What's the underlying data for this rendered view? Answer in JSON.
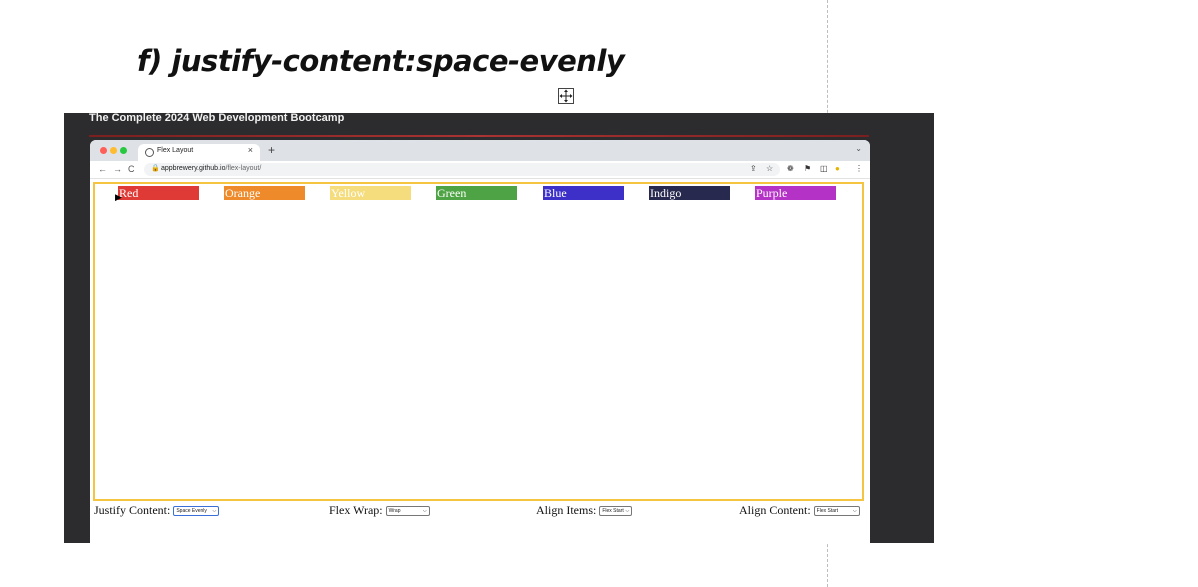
{
  "document": {
    "heading": "f) justify-content:space-evenly"
  },
  "video": {
    "title": "The Complete 2024 Web Development Bootcamp"
  },
  "browser": {
    "tab_title": "Flex Layout",
    "tab_close": "×",
    "new_tab": "+",
    "tab_menu": "⌄",
    "nav_back": "←",
    "nav_forward": "→",
    "nav_reload": "C",
    "url_host": "appbrewery.github.io",
    "url_path": "/flex-layout/",
    "toolbar_icons": [
      "share-icon",
      "star-icon",
      "extension-icon",
      "puzzle-icon",
      "sidebar-icon",
      "profile-icon",
      "more-icon"
    ]
  },
  "flex_items": [
    {
      "label": "Red",
      "color": "#e03a37"
    },
    {
      "label": "Orange",
      "color": "#ee8a29"
    },
    {
      "label": "Yellow",
      "color": "#f5dc7c"
    },
    {
      "label": "Green",
      "color": "#4ea344"
    },
    {
      "label": "Blue",
      "color": "#3d30c8"
    },
    {
      "label": "Indigo",
      "color": "#27294f"
    },
    {
      "label": "Purple",
      "color": "#b532c6"
    }
  ],
  "controls": {
    "justify_content": {
      "label": "Justify Content:",
      "value": "Space Evenly"
    },
    "flex_wrap": {
      "label": "Flex Wrap:",
      "value": "Wrap"
    },
    "align_items": {
      "label": "Align Items:",
      "value": "Flex Start"
    },
    "align_content": {
      "label": "Align Content:",
      "value": "Flex Start"
    }
  },
  "colors": {
    "viewport_border": "#f5c542",
    "video_background": "#2c2c2e",
    "tab_bar": "#dee1e6"
  }
}
